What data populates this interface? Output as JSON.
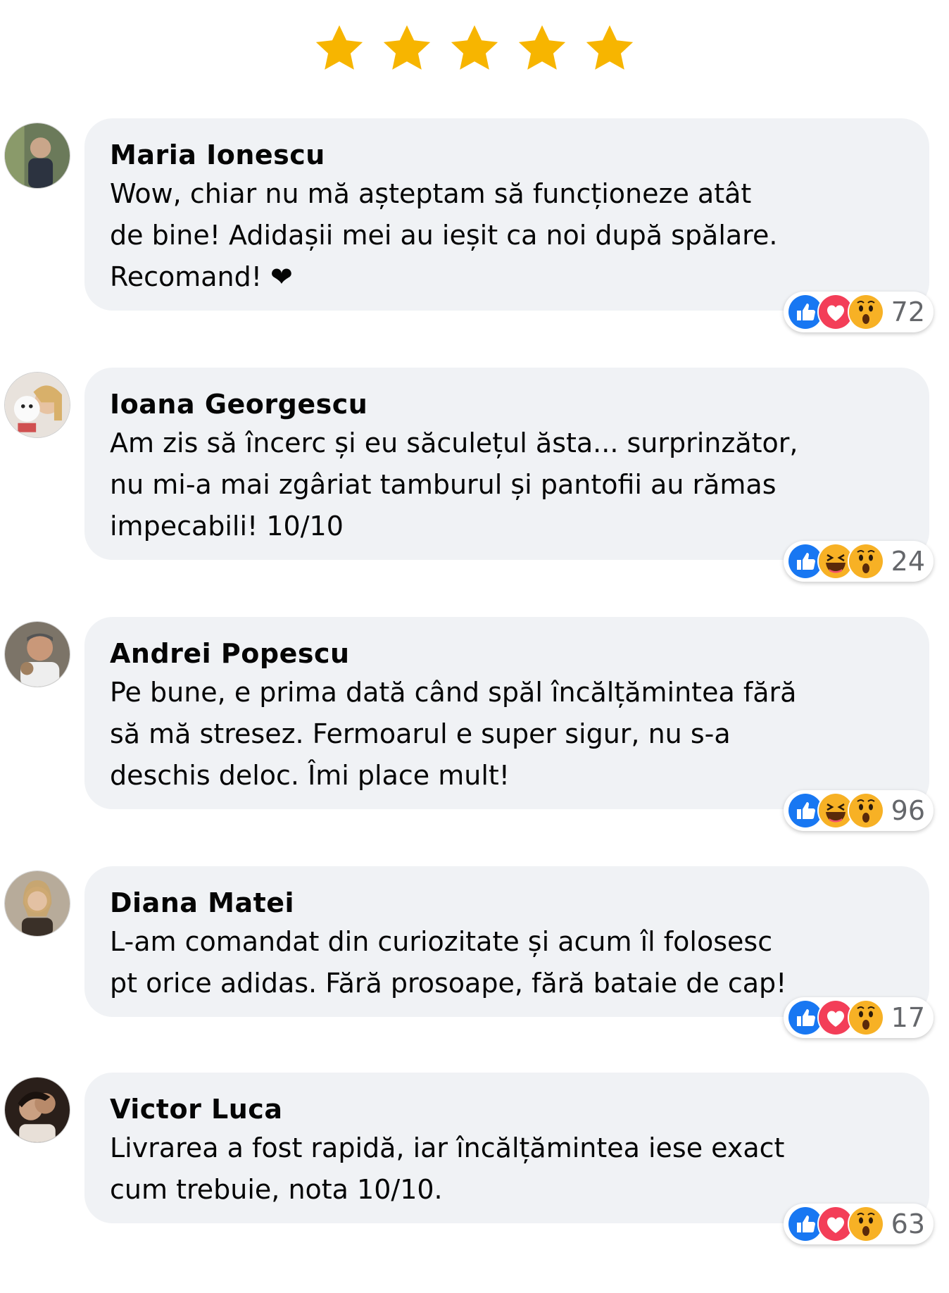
{
  "rating": {
    "value": 5,
    "max": 5,
    "color": "#f7b500"
  },
  "comments": [
    {
      "author": "Maria Ionescu",
      "text": "Wow, chiar nu mă așteptam să funcționeze atât\nde bine! Adidașii mei au ieșit ca noi după spălare.\nRecomand! ❤",
      "reactions": [
        "like",
        "love",
        "wow"
      ],
      "count": "72"
    },
    {
      "author": "Ioana Georgescu",
      "text": "Am zis să încerc și eu săculețul ăsta... surprinzător,\nnu mi-a mai zgâriat tamburul și pantofii au rămas\nimpecabili! 10/10",
      "reactions": [
        "like",
        "haha",
        "wow"
      ],
      "count": "24"
    },
    {
      "author": "Andrei Popescu",
      "text": "Pe bune, e prima dată când spăl încălțămintea fără\nsă mă stresez. Fermoarul e super sigur, nu s-a\ndeschis deloc. Îmi place mult!",
      "reactions": [
        "like",
        "haha",
        "wow"
      ],
      "count": "96"
    },
    {
      "author": "Diana Matei",
      "text": "L-am comandat din curiozitate și acum îl folosesc\npt orice adidas. Fără prosoape, fără bataie de cap!",
      "reactions": [
        "like",
        "love",
        "wow"
      ],
      "count": "17"
    },
    {
      "author": "Victor Luca",
      "text": "Livrarea a fost rapidă, iar încălțămintea iese exact\ncum trebuie, nota 10/10.",
      "reactions": [
        "like",
        "love",
        "wow"
      ],
      "count": "63"
    }
  ],
  "colors": {
    "like": "#1877f2",
    "love": "#f33e58",
    "emoji_yellow": "#f7b125",
    "bubble_bg": "#f0f2f5",
    "count_text": "#65676b"
  }
}
